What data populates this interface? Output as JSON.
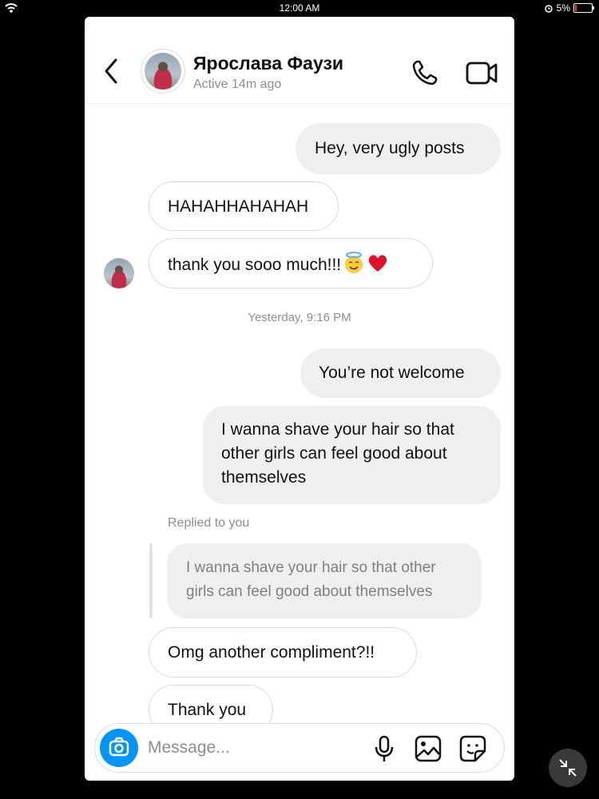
{
  "status_bar": {
    "time": "12:00 AM",
    "battery": "5%",
    "battery_level": 0.05
  },
  "header": {
    "contact_name": "Ярослава Фаузи",
    "status": "Active 14m ago"
  },
  "messages": {
    "m1": "Hey, very ugly posts",
    "m2": "HAHAHHAHAHAH",
    "m3": "thank you sooo much!!!",
    "timestamp": "Yesterday, 9:16 PM",
    "m4": "You’re not welcome",
    "m5": "I wanna shave your hair so that other girls can feel good about themselves",
    "reply_label": "Replied to you",
    "quoted": "I wanna shave your hair so that other girls can feel good about themselves",
    "m6": "Omg another compliment?!!",
    "m7": "Thank you"
  },
  "composer": {
    "placeholder": "Message..."
  },
  "colors": {
    "accent": "#0095f6",
    "sent_bubble": "#efefef",
    "heart": "#e0112b",
    "battery_low": "#ff3b30"
  },
  "icons": [
    "back-icon",
    "phone-icon",
    "video-icon",
    "camera-icon",
    "mic-icon",
    "image-icon",
    "sticker-icon",
    "halo-emoji-icon",
    "heart-emoji-icon",
    "collapse-icon"
  ]
}
